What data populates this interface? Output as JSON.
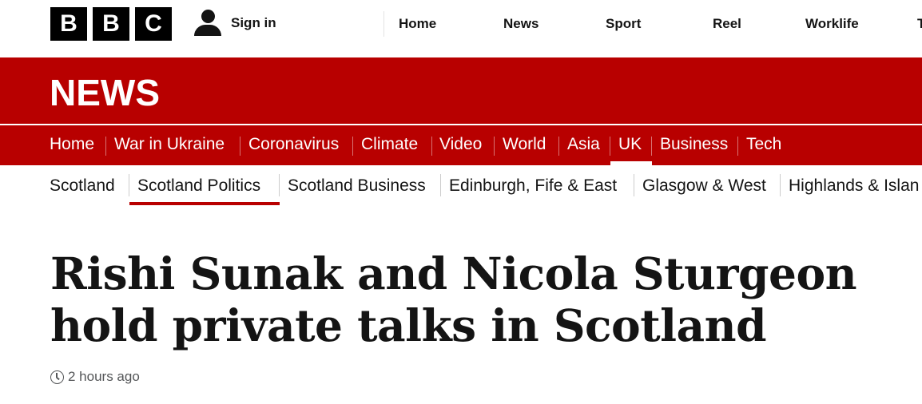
{
  "header": {
    "logo_letters": [
      "B",
      "B",
      "C"
    ],
    "signin_label": "Sign in",
    "nav": [
      "Home",
      "News",
      "Sport",
      "Reel",
      "Worklife",
      "T"
    ]
  },
  "news_band": {
    "title": "NEWS"
  },
  "section_nav": {
    "items": [
      "Home",
      "War in Ukraine",
      "Coronavirus",
      "Climate",
      "Video",
      "World",
      "Asia",
      "UK",
      "Business",
      "Tech"
    ],
    "active": "UK"
  },
  "sub_nav": {
    "items": [
      "Scotland",
      "Scotland Politics",
      "Scotland Business",
      "Edinburgh, Fife & East",
      "Glasgow & West",
      "Highlands & Islan"
    ],
    "active": "Scotland Politics"
  },
  "article": {
    "headline": "Rishi Sunak and Nicola Sturgeon hold private talks in Scotland",
    "timestamp": "2 hours ago"
  },
  "colors": {
    "brand_red": "#b80000",
    "text": "#141414",
    "meta": "#545658"
  },
  "icons": [
    "user-icon",
    "clock-icon"
  ]
}
